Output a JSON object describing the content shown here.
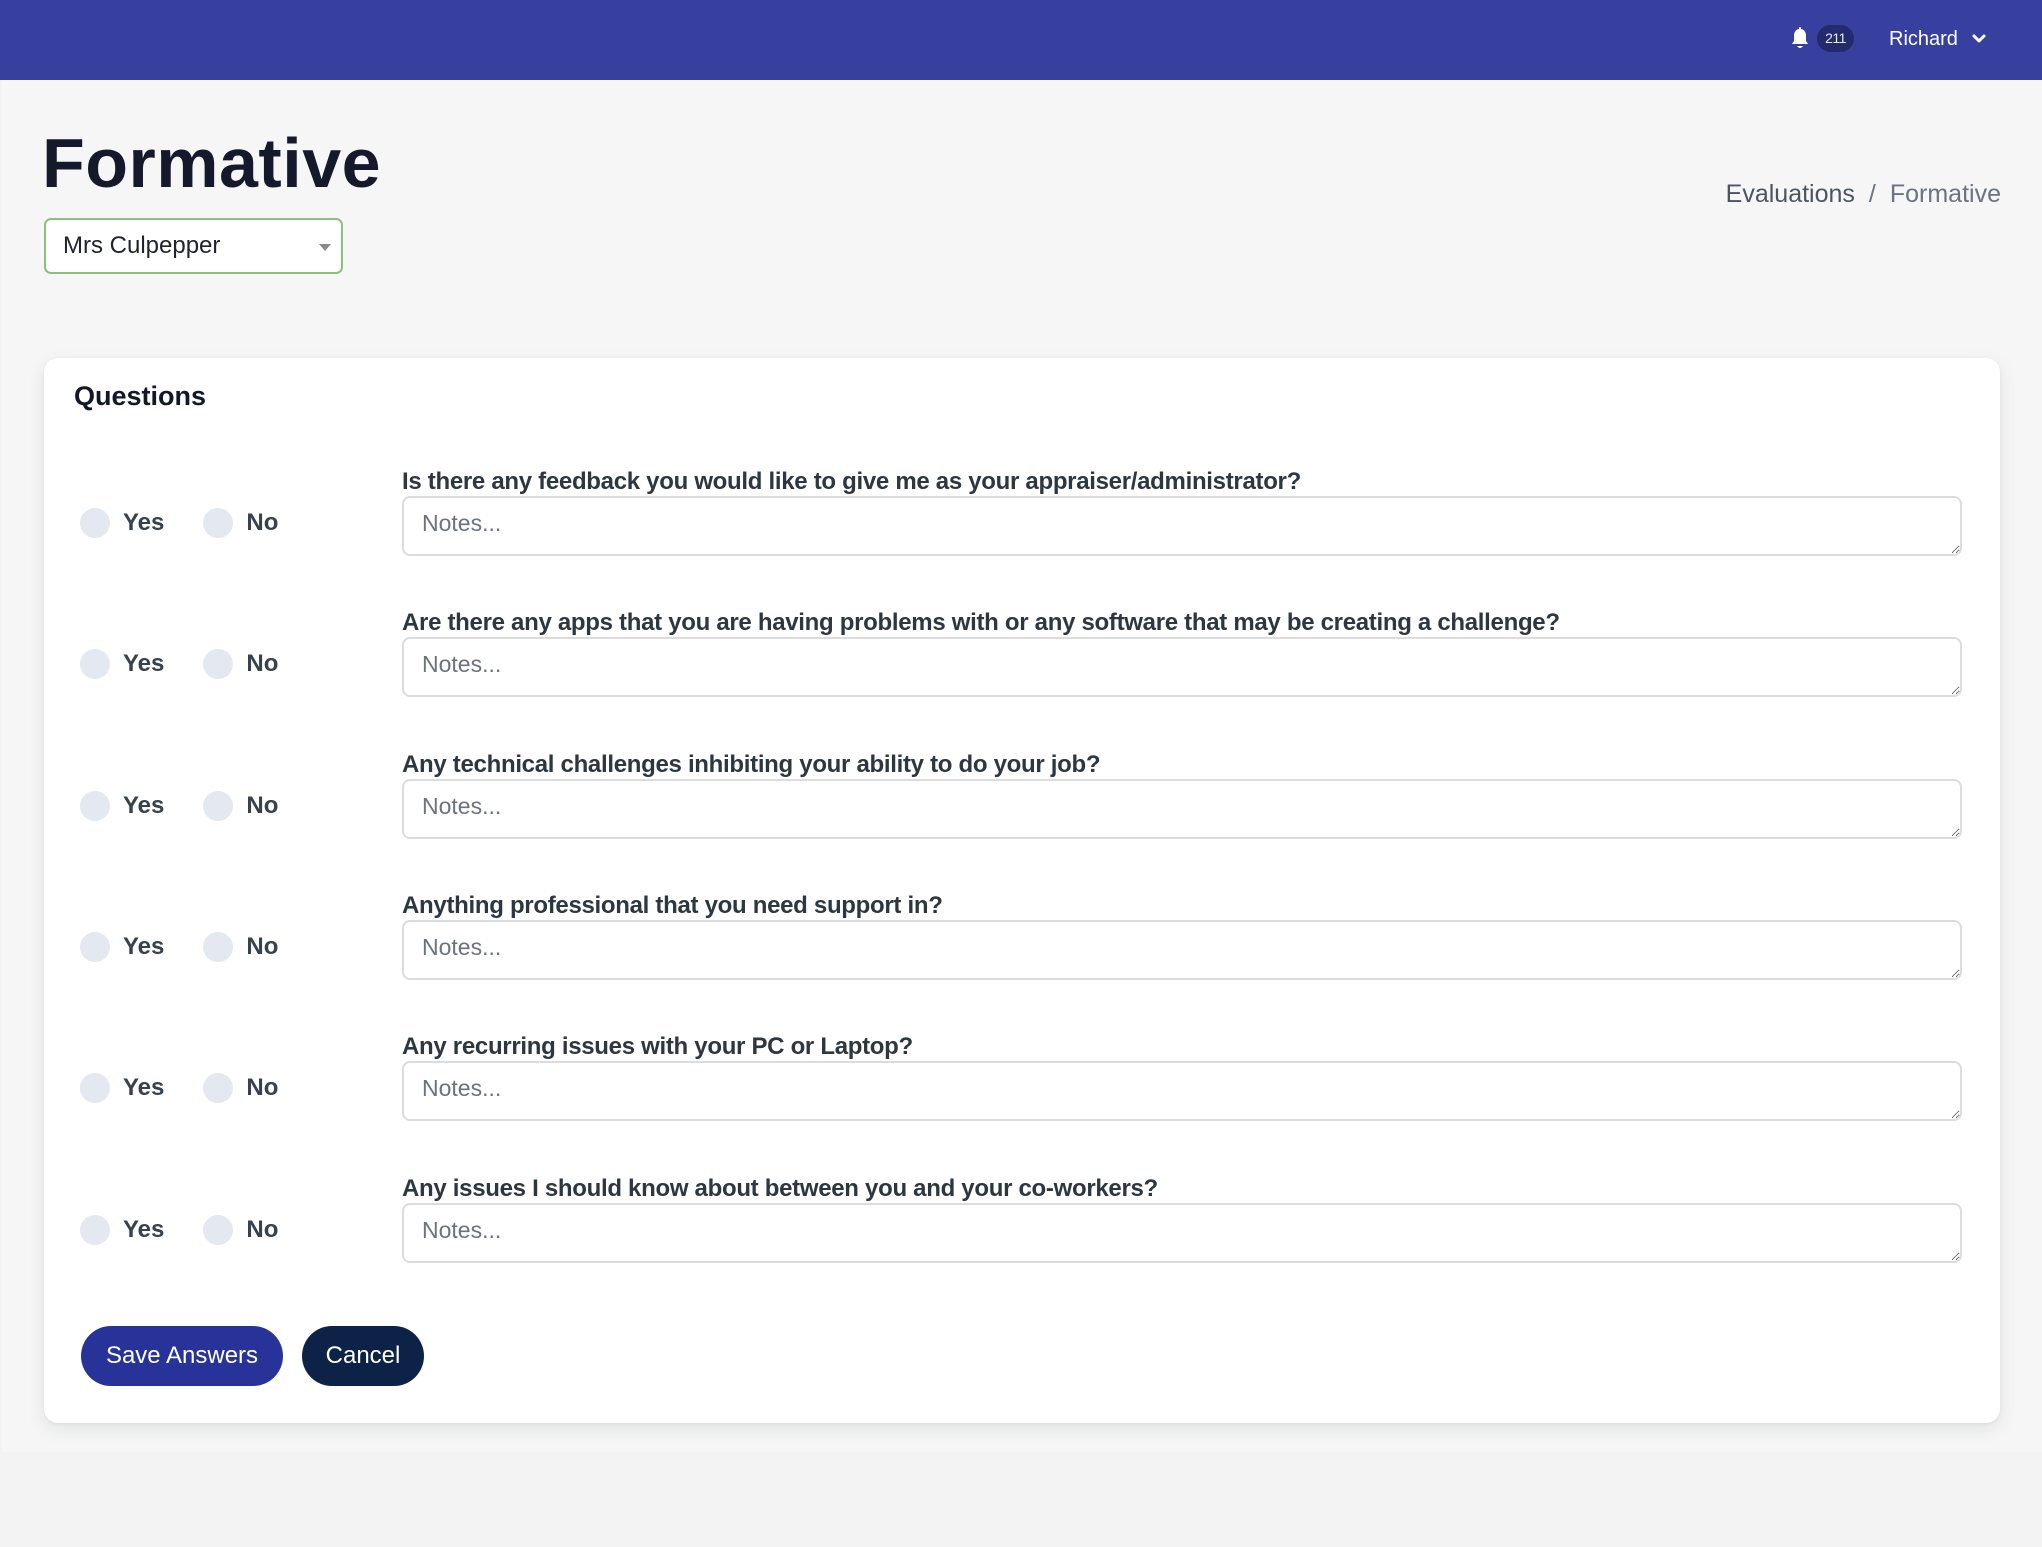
{
  "topbar": {
    "notifications_count": "211",
    "user_name": "Richard",
    "background_color": "#37409f"
  },
  "page": {
    "title": "Formative",
    "person_select": {
      "selected": "Mrs Culpepper"
    },
    "breadcrumb": [
      {
        "label": "Evaluations"
      },
      {
        "label": "Formative"
      }
    ],
    "breadcrumb_separator": "/"
  },
  "questions_card": {
    "title": "Questions",
    "yes_label": "Yes",
    "no_label": "No",
    "notes_placeholder": "Notes...",
    "questions": [
      {
        "text": "Is there any feedback you would like to give me as your appraiser/administrator?",
        "answer": null,
        "notes": ""
      },
      {
        "text": "Are there any apps that you are having problems with or any software that may be creating a challenge?",
        "answer": null,
        "notes": ""
      },
      {
        "text": "Any technical challenges inhibiting your ability to do your job?",
        "answer": null,
        "notes": ""
      },
      {
        "text": "Anything professional that you need support in?",
        "answer": null,
        "notes": ""
      },
      {
        "text": "Any recurring issues with your PC or Laptop?",
        "answer": null,
        "notes": ""
      },
      {
        "text": "Any issues I should know about between you and your co-workers?",
        "answer": null,
        "notes": ""
      }
    ],
    "save_label": "Save Answers",
    "cancel_label": "Cancel"
  },
  "colors": {
    "primary_button": "#28339a",
    "cancel_button": "#0d2247",
    "select_border": "#8bc07a",
    "radio_unchecked": "#e3e8f1"
  }
}
